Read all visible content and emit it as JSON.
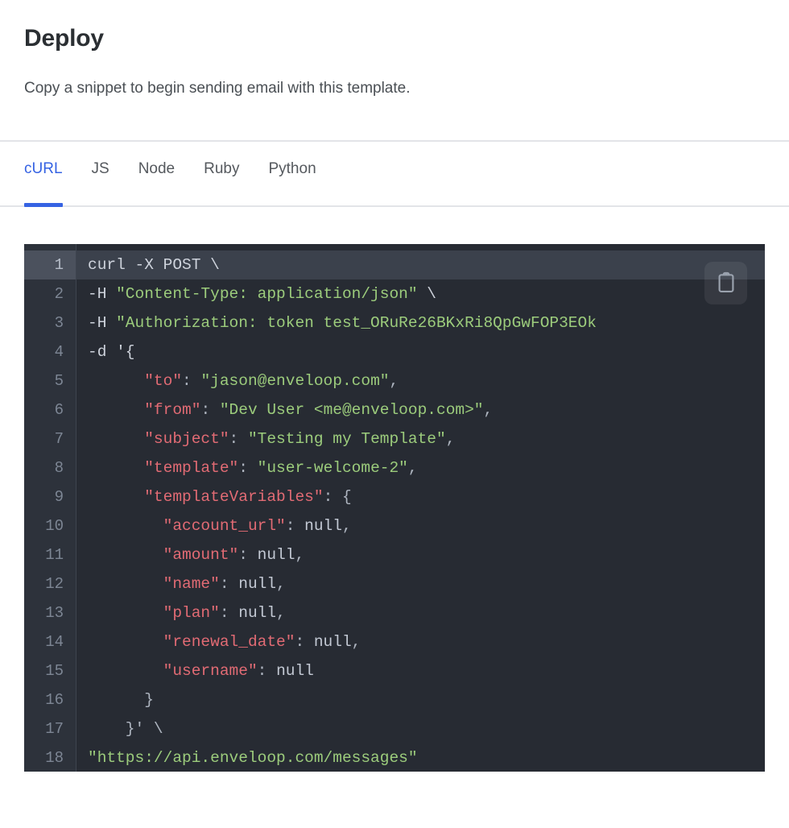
{
  "header": {
    "title": "Deploy",
    "subtitle": "Copy a snippet to begin sending email with this template."
  },
  "tabs": {
    "active_index": 0,
    "items": [
      {
        "label": "cURL"
      },
      {
        "label": "JS"
      },
      {
        "label": "Node"
      },
      {
        "label": "Ruby"
      },
      {
        "label": "Python"
      }
    ],
    "active_color": "#3663e3",
    "inactive_color": "#55595e"
  },
  "code_block": {
    "language": "curl",
    "copy_button": {
      "icon": "clipboard-icon",
      "label": ""
    },
    "theme": {
      "background": "#272b33",
      "gutter_background": "#2d323b",
      "highlight_background": "#3b414c",
      "line_number_color": "#7d8694",
      "string_color": "#9ccc7c",
      "key_color": "#e26b74",
      "plain_color": "#ced3dc",
      "null_color": "#c3c9d4"
    },
    "highlighted_line": 1,
    "line_numbers": [
      "1",
      "2",
      "3",
      "4",
      "5",
      "6",
      "7",
      "8",
      "9",
      "10",
      "11",
      "12",
      "13",
      "14",
      "15",
      "16",
      "17",
      "18"
    ],
    "lines": [
      {
        "n": "1",
        "text": "curl -X POST \\"
      },
      {
        "n": "2",
        "text": "-H \"Content-Type: application/json\" \\"
      },
      {
        "n": "3",
        "text": "-H \"Authorization: token test_ORuRe26BKxRi8QpGwFOP3EOk"
      },
      {
        "n": "4",
        "text": "-d '{"
      },
      {
        "n": "5",
        "text": "      \"to\": \"jason@enveloop.com\","
      },
      {
        "n": "6",
        "text": "      \"from\": \"Dev User <me@enveloop.com>\","
      },
      {
        "n": "7",
        "text": "      \"subject\": \"Testing my Template\","
      },
      {
        "n": "8",
        "text": "      \"template\": \"user-welcome-2\","
      },
      {
        "n": "9",
        "text": "      \"templateVariables\": {"
      },
      {
        "n": "10",
        "text": "        \"account_url\": null,"
      },
      {
        "n": "11",
        "text": "        \"amount\": null,"
      },
      {
        "n": "12",
        "text": "        \"name\": null,"
      },
      {
        "n": "13",
        "text": "        \"plan\": null,"
      },
      {
        "n": "14",
        "text": "        \"renewal_date\": null,"
      },
      {
        "n": "15",
        "text": "        \"username\": null"
      },
      {
        "n": "16",
        "text": "      }"
      },
      {
        "n": "17",
        "text": "    }' \\"
      },
      {
        "n": "18",
        "text": "\"https://api.enveloop.com/messages\""
      }
    ],
    "tokens": {
      "l1": [
        {
          "t": "curl -X POST \\",
          "c": "tok-plain"
        }
      ],
      "l2": [
        {
          "t": "-H ",
          "c": "tok-plain"
        },
        {
          "t": "\"Content-Type: application/json\"",
          "c": "tok-str"
        },
        {
          "t": " \\",
          "c": "tok-plain"
        }
      ],
      "l3": [
        {
          "t": "-H ",
          "c": "tok-plain"
        },
        {
          "t": "\"Authorization: token test_ORuRe26BKxRi8QpGwFOP3EOk",
          "c": "tok-str"
        }
      ],
      "l4": [
        {
          "t": "-d '{",
          "c": "tok-plain"
        }
      ],
      "l5": [
        {
          "t": "      ",
          "c": "tok-plain"
        },
        {
          "t": "\"to\"",
          "c": "tok-key"
        },
        {
          "t": ": ",
          "c": "tok-punc"
        },
        {
          "t": "\"jason@enveloop.com\"",
          "c": "tok-str"
        },
        {
          "t": ",",
          "c": "tok-punc"
        }
      ],
      "l6": [
        {
          "t": "      ",
          "c": "tok-plain"
        },
        {
          "t": "\"from\"",
          "c": "tok-key"
        },
        {
          "t": ": ",
          "c": "tok-punc"
        },
        {
          "t": "\"Dev User <me@enveloop.com>\"",
          "c": "tok-str"
        },
        {
          "t": ",",
          "c": "tok-punc"
        }
      ],
      "l7": [
        {
          "t": "      ",
          "c": "tok-plain"
        },
        {
          "t": "\"subject\"",
          "c": "tok-key"
        },
        {
          "t": ": ",
          "c": "tok-punc"
        },
        {
          "t": "\"Testing my Template\"",
          "c": "tok-str"
        },
        {
          "t": ",",
          "c": "tok-punc"
        }
      ],
      "l8": [
        {
          "t": "      ",
          "c": "tok-plain"
        },
        {
          "t": "\"template\"",
          "c": "tok-key"
        },
        {
          "t": ": ",
          "c": "tok-punc"
        },
        {
          "t": "\"user-welcome-2\"",
          "c": "tok-str"
        },
        {
          "t": ",",
          "c": "tok-punc"
        }
      ],
      "l9": [
        {
          "t": "      ",
          "c": "tok-plain"
        },
        {
          "t": "\"templateVariables\"",
          "c": "tok-key"
        },
        {
          "t": ": {",
          "c": "tok-punc"
        }
      ],
      "l10": [
        {
          "t": "        ",
          "c": "tok-plain"
        },
        {
          "t": "\"account_url\"",
          "c": "tok-key"
        },
        {
          "t": ": ",
          "c": "tok-punc"
        },
        {
          "t": "null",
          "c": "tok-null"
        },
        {
          "t": ",",
          "c": "tok-punc"
        }
      ],
      "l11": [
        {
          "t": "        ",
          "c": "tok-plain"
        },
        {
          "t": "\"amount\"",
          "c": "tok-key"
        },
        {
          "t": ": ",
          "c": "tok-punc"
        },
        {
          "t": "null",
          "c": "tok-null"
        },
        {
          "t": ",",
          "c": "tok-punc"
        }
      ],
      "l12": [
        {
          "t": "        ",
          "c": "tok-plain"
        },
        {
          "t": "\"name\"",
          "c": "tok-key"
        },
        {
          "t": ": ",
          "c": "tok-punc"
        },
        {
          "t": "null",
          "c": "tok-null"
        },
        {
          "t": ",",
          "c": "tok-punc"
        }
      ],
      "l13": [
        {
          "t": "        ",
          "c": "tok-plain"
        },
        {
          "t": "\"plan\"",
          "c": "tok-key"
        },
        {
          "t": ": ",
          "c": "tok-punc"
        },
        {
          "t": "null",
          "c": "tok-null"
        },
        {
          "t": ",",
          "c": "tok-punc"
        }
      ],
      "l14": [
        {
          "t": "        ",
          "c": "tok-plain"
        },
        {
          "t": "\"renewal_date\"",
          "c": "tok-key"
        },
        {
          "t": ": ",
          "c": "tok-punc"
        },
        {
          "t": "null",
          "c": "tok-null"
        },
        {
          "t": ",",
          "c": "tok-punc"
        }
      ],
      "l15": [
        {
          "t": "        ",
          "c": "tok-plain"
        },
        {
          "t": "\"username\"",
          "c": "tok-key"
        },
        {
          "t": ": ",
          "c": "tok-punc"
        },
        {
          "t": "null",
          "c": "tok-null"
        }
      ],
      "l16": [
        {
          "t": "      }",
          "c": "tok-punc"
        }
      ],
      "l17": [
        {
          "t": "    }' \\",
          "c": "tok-punc"
        }
      ],
      "l18": [
        {
          "t": "\"https://api.enveloop.com/messages\"",
          "c": "tok-str"
        }
      ]
    }
  }
}
